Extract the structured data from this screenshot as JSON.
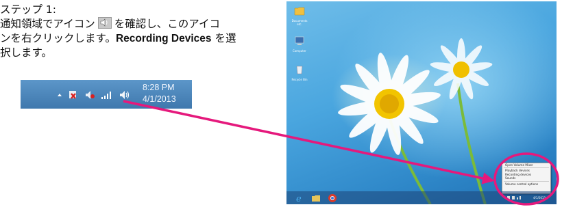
{
  "instructions": {
    "step_title": "ステップ 1:",
    "line1_before": "通知領域でアイコン",
    "line1_after": "を確認し、このアイコ",
    "line2_before": "ンを右クリックします。",
    "line2_bold": "Recording Devices",
    "line2_after": " を選",
    "line3": "択します。",
    "inline_icon": "speaker-icon"
  },
  "tray": {
    "icons": [
      "up-arrow-icon",
      "flag-error-icon",
      "speaker-red-icon",
      "signal-icon",
      "speaker-icon"
    ],
    "time": "8:28 PM",
    "date": "4/1/2013",
    "background": "#4a84bb"
  },
  "desktop": {
    "icons": [
      {
        "name": "folder-icon",
        "label": "Documents etc."
      },
      {
        "name": "computer-icon",
        "label": "Computer"
      },
      {
        "name": "recycle-bin-icon",
        "label": "Recycle Bin"
      }
    ],
    "taskbar_icons": [
      "ie-icon",
      "explorer-icon",
      "chrome-icon"
    ],
    "context_menu": {
      "items": [
        "Open Volume Mixer",
        "Playback devices",
        "Recording devices",
        "Sounds",
        "Volume control options"
      ]
    },
    "tray_date": "4/1/2013"
  },
  "highlight_color": "#e5197c"
}
